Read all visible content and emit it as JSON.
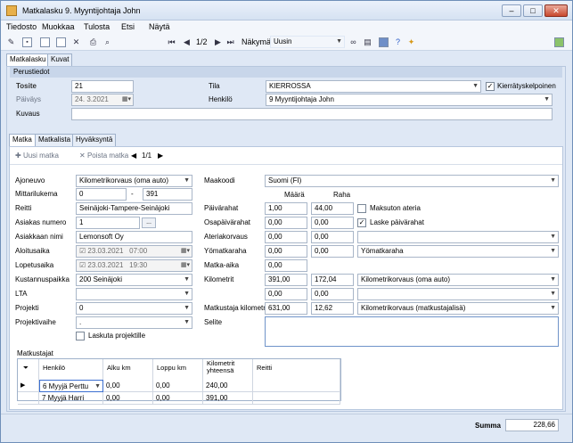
{
  "window": {
    "title": "Matkalasku 9. Myyntijohtaja John",
    "min_label": "–",
    "max_label": "□",
    "close_label": "✕"
  },
  "menu": [
    "Tiedosto",
    "Muokkaa",
    "Tulosta",
    "Etsi",
    "Näytä"
  ],
  "toolbar": {
    "page": "1/2",
    "view_label": "Näkymä",
    "view_value": "Uusin"
  },
  "main_tabs": [
    "Matkalasku",
    "Kuvat"
  ],
  "perustiedot": {
    "group_title": "Perustiedot",
    "tosite_label": "Tosite",
    "tosite_value": "21",
    "paivays_label": "Päiväys",
    "paivays_value": "24. 3.2021",
    "kuvaus_label": "Kuvaus",
    "kuvaus_value": "",
    "tila_label": "Tila",
    "tila_value": "KIERROSSA",
    "henkilo_label": "Henkilö",
    "henkilo_value": "9 Myyntijohtaja John",
    "kierratys_label": "Kierrätyskelpoinen",
    "kierratys_checked": true
  },
  "sub_tabs": [
    "Matka",
    "Matkalista",
    "Hyväksyntä"
  ],
  "matka_toolbar": {
    "new_label": "Uusi matka",
    "delete_label": "Poista matka",
    "page": "1/1"
  },
  "matka_left": {
    "ajoneuvo_label": "Ajoneuvo",
    "ajoneuvo_value": "Kilometrikorvaus (oma auto)",
    "mittarilukema_label": "Mittarilukema",
    "mittari_start": "0",
    "mittari_sep": "-",
    "mittari_end": "391",
    "reitti_label": "Reitti",
    "reitti_value": "Seinäjoki-Tampere-Seinäjoki",
    "asiakasnumero_label": "Asiakas numero",
    "asiakasnumero_value": "1",
    "browse_label": "...",
    "asiakasnimi_label": "Asiakkaan nimi",
    "asiakasnimi_value": "Lemonsoft Oy",
    "aloitusaika_label": "Aloitusaika",
    "aloitus_date": "23.03.2021",
    "aloitus_time": "07:00",
    "lopetusaika_label": "Lopetusaika",
    "lopetus_date": "23.03.2021",
    "lopetus_time": "19:30",
    "kustannuspaikka_label": "Kustannuspaikka",
    "kustannuspaikka_value": "200 Seinäjoki",
    "lta_label": "LTA",
    "lta_value": "",
    "projekti_label": "Projekti",
    "projekti_value": "0",
    "projektivaihe_label": "Projektivaihe",
    "projektivaihe_value": ".",
    "laskuta_label": "Laskuta projektille",
    "laskuta_checked": false
  },
  "matka_right": {
    "maakoodi_label": "Maakoodi",
    "maakoodi_value": "Suomi (FI)",
    "maara_header": "Määrä",
    "raha_header": "Raha",
    "rows": [
      {
        "label": "Päivärahat",
        "maara": "1,00",
        "raha": "44,00"
      },
      {
        "label": "Osapäivärahat",
        "maara": "0,00",
        "raha": "0,00"
      },
      {
        "label": "Ateriakorvaus",
        "maara": "0,00",
        "raha": "0,00"
      },
      {
        "label": "Yömatkaraha",
        "maara": "0,00",
        "raha": "0,00"
      },
      {
        "label": "Matka-aika",
        "maara": "0,00",
        "raha": ""
      },
      {
        "label": "Kilometrit",
        "maara": "391,00",
        "raha": "172,04"
      },
      {
        "label": "",
        "maara": "0,00",
        "raha": "0,00"
      },
      {
        "label": "Matkustaja kilometrit",
        "maara": "631,00",
        "raha": "12,62"
      }
    ],
    "maksuton_label": "Maksuton ateria",
    "maksuton_checked": false,
    "laske_label": "Laske päivärahat",
    "laske_checked": true,
    "combo_row3": "",
    "combo_row4": "Yömatkaraha",
    "combo_km": "Kilometrikorvaus (oma auto)",
    "combo_km2": "",
    "combo_matkustaja": "Kilometrikorvaus (matkustajalisä)",
    "selite_label": "Selite",
    "selite_value": ""
  },
  "matkustajat": {
    "title": "Matkustajat",
    "headers": [
      "Henkilö",
      "Alku km",
      "Loppu km",
      "Kilometrit yhteensä",
      "Reitti"
    ],
    "rows": [
      {
        "henkilo": "6 Myyjä Perttu",
        "alku": "0,00",
        "loppu": "0,00",
        "yhteensa": "240,00",
        "reitti": ""
      },
      {
        "henkilo": "7 Myyjä Harri",
        "alku": "0,00",
        "loppu": "0,00",
        "yhteensa": "391,00",
        "reitti": ""
      }
    ]
  },
  "summa": {
    "label": "Summa",
    "value": "228,66"
  },
  "colors": {
    "accent": "#4a6fa5",
    "header_fill": "#c8d6ea",
    "window_bg": "#dfe8f5"
  }
}
